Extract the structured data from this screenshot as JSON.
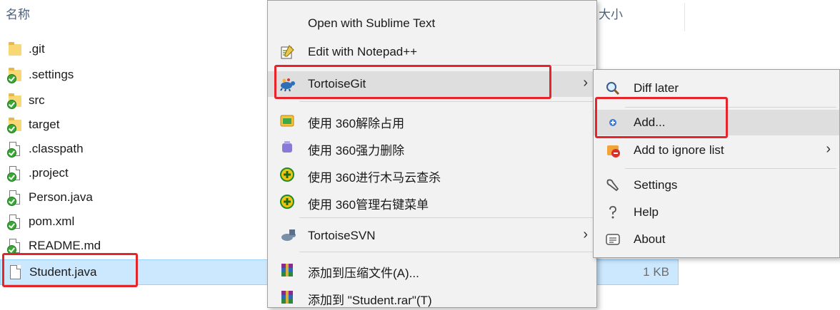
{
  "explorer": {
    "col_name": "名称",
    "col_size": "大小",
    "files": [
      {
        "name": ".git",
        "icon": "folder-icon",
        "size": ""
      },
      {
        "name": ".settings",
        "icon": "folder-git-ok-icon",
        "size": ""
      },
      {
        "name": "src",
        "icon": "folder-git-ok-icon",
        "size": ""
      },
      {
        "name": "target",
        "icon": "folder-git-ok-icon",
        "size": ""
      },
      {
        "name": ".classpath",
        "icon": "file-git-ok-icon",
        "size": ""
      },
      {
        "name": ".project",
        "icon": "file-git-ok-icon",
        "size": ""
      },
      {
        "name": "Person.java",
        "icon": "file-git-ok-icon",
        "size": ""
      },
      {
        "name": "pom.xml",
        "icon": "file-git-ok-icon",
        "size": ""
      },
      {
        "name": "README.md",
        "icon": "file-git-ok-icon",
        "size": ""
      },
      {
        "name": "Student.java",
        "icon": "file-icon",
        "size": "1 KB",
        "selected": true
      }
    ]
  },
  "context_menu": {
    "items": [
      {
        "label": "Open with Sublime Text",
        "icon": ""
      },
      {
        "label": "Edit with Notepad++",
        "icon": "notepad-plus-plus-icon"
      },
      {
        "label": "TortoiseGit",
        "icon": "tortoisegit-icon",
        "submenu": true,
        "hover": true
      },
      {
        "label": "使用 360解除占用",
        "icon": "unlock-360-icon"
      },
      {
        "label": "使用 360强力删除",
        "icon": "delete-360-icon"
      },
      {
        "label": "使用 360进行木马云查杀",
        "icon": "scan-360-icon"
      },
      {
        "label": "使用 360管理右键菜单",
        "icon": "manage-360-icon"
      },
      {
        "label": "TortoiseSVN",
        "icon": "tortoisesvn-icon",
        "submenu": true
      },
      {
        "label": "添加到压缩文件(A)...",
        "icon": "winrar-icon"
      },
      {
        "label": "添加到 \"Student.rar\"(T)",
        "icon": "winrar-icon"
      }
    ]
  },
  "git_submenu": {
    "items": [
      {
        "label": "Diff later",
        "icon": "magnifier-icon"
      },
      {
        "label": "Add...",
        "icon": "add-icon",
        "hover": true
      },
      {
        "label": "Add to ignore list",
        "icon": "ignore-icon",
        "submenu": true
      },
      {
        "label": "Settings",
        "icon": "settings-wrench-icon"
      },
      {
        "label": "Help",
        "icon": "help-icon"
      },
      {
        "label": "About",
        "icon": "about-icon"
      }
    ]
  },
  "colors": {
    "highlight_box": "#e8242b",
    "selection": "#cce8ff",
    "menu_bg": "#f2f2f2",
    "menu_hover": "#dedede"
  }
}
